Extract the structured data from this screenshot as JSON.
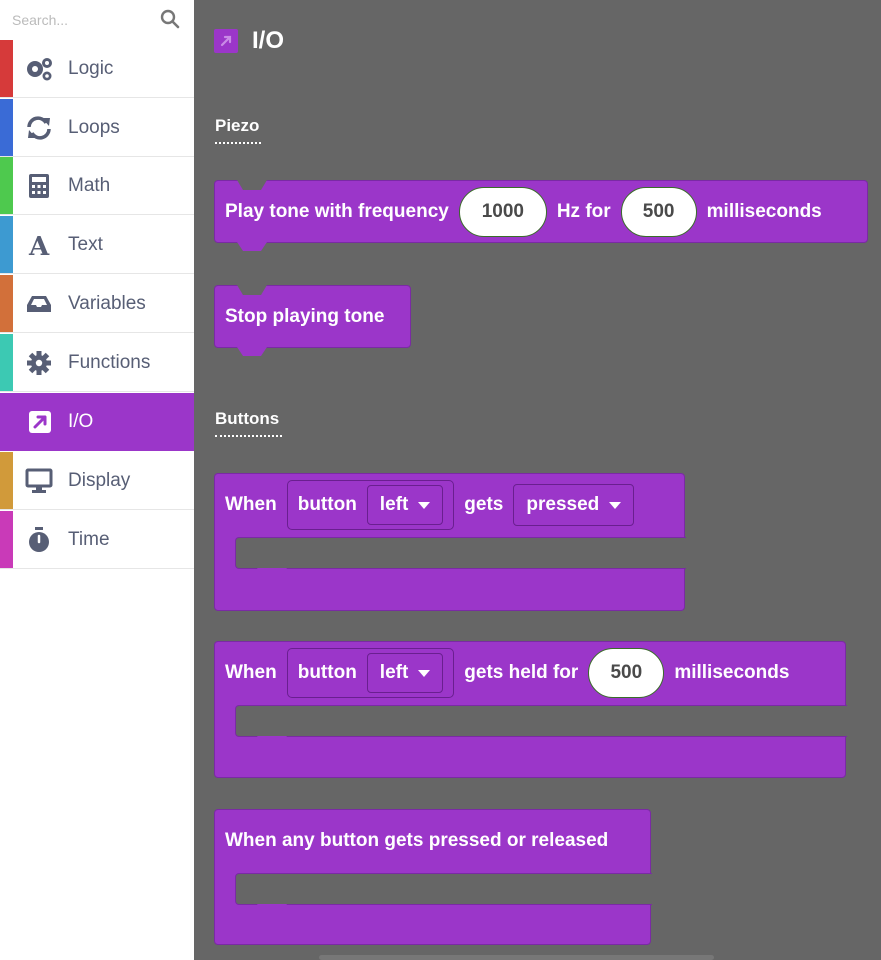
{
  "search": {
    "placeholder": "Search..."
  },
  "categories": [
    {
      "label": "Logic",
      "color": "#d63a3a",
      "icon": "gears-icon"
    },
    {
      "label": "Loops",
      "color": "#3a6bd6",
      "icon": "refresh-icon"
    },
    {
      "label": "Math",
      "color": "#4ec94e",
      "icon": "calculator-icon"
    },
    {
      "label": "Text",
      "color": "#3d9ad1",
      "icon": "letter-a-icon"
    },
    {
      "label": "Variables",
      "color": "#d2703a",
      "icon": "inbox-icon"
    },
    {
      "label": "Functions",
      "color": "#3cc9b3",
      "icon": "gear-icon"
    },
    {
      "label": "I/O",
      "color": "#9b36c9",
      "icon": "external-link-icon",
      "selected": true
    },
    {
      "label": "Display",
      "color": "#d19a3a",
      "icon": "monitor-icon"
    },
    {
      "label": "Time",
      "color": "#c93ab8",
      "icon": "stopwatch-icon"
    }
  ],
  "workspace": {
    "title": "I/O",
    "accent": "#9b36c9",
    "background": "#666666",
    "sections": {
      "piezo": "Piezo",
      "buttons": "Buttons"
    },
    "blocks": {
      "play_tone": {
        "prefix": "Play tone with frequency",
        "frequency": "1000",
        "middle": "Hz for",
        "duration": "500",
        "suffix": "milliseconds"
      },
      "stop_tone": {
        "label": "Stop playing tone"
      },
      "when_pressed": {
        "when": "When",
        "button": "button",
        "which": "left",
        "gets": "gets",
        "state": "pressed"
      },
      "when_held": {
        "when": "When",
        "button": "button",
        "which": "left",
        "gets_held": "gets held for",
        "duration": "500",
        "suffix": "milliseconds"
      },
      "any_button": {
        "label": "When any button gets pressed or released"
      }
    }
  }
}
